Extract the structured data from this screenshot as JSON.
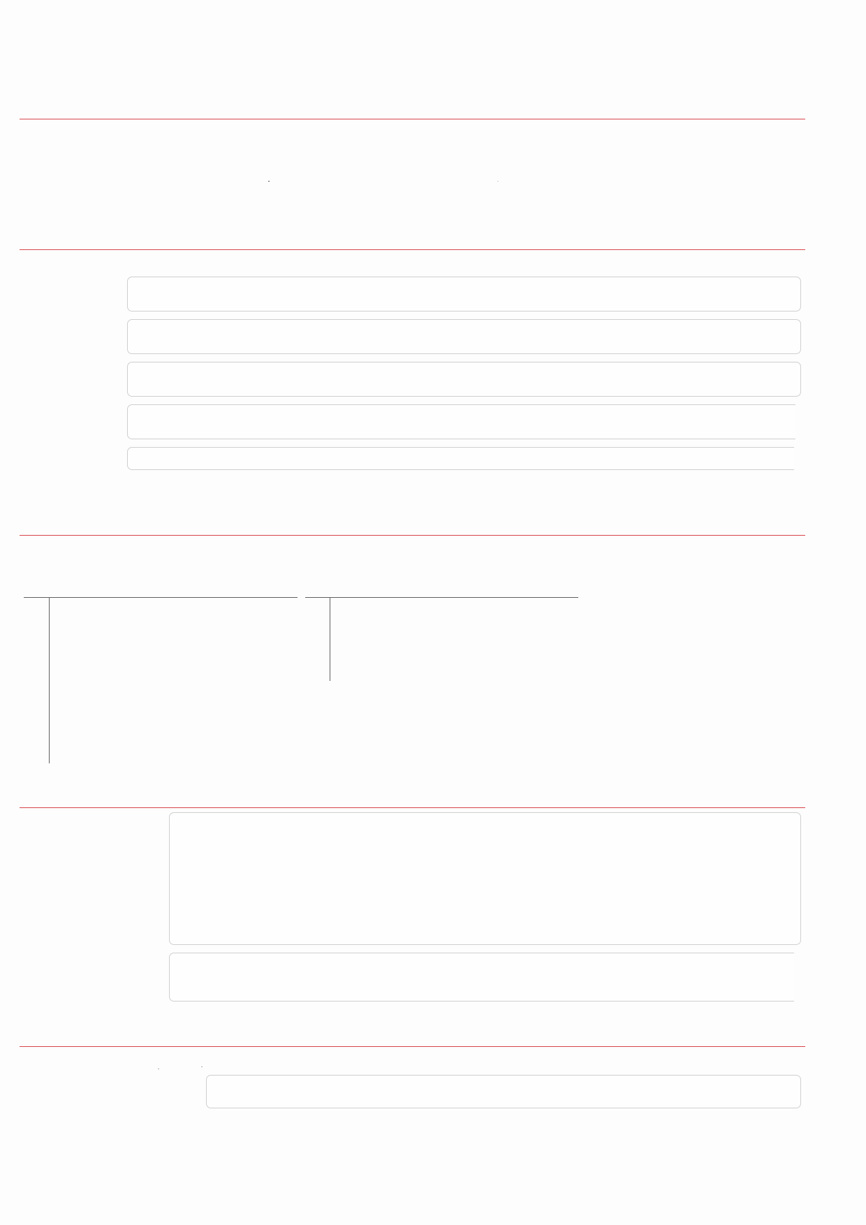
{
  "page": {
    "rule_color": "#d8454c",
    "field_border_color": "#cfcfcf",
    "line_color": "#5f5f5f",
    "background": "#fdfdfd"
  }
}
